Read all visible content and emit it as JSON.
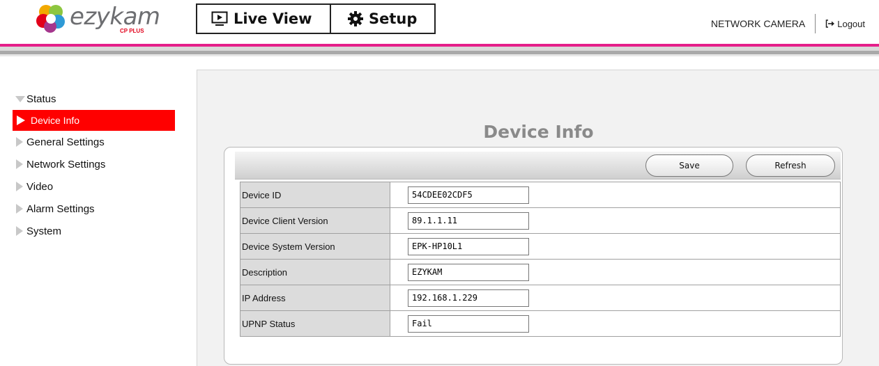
{
  "brand": {
    "name": "ezykam",
    "sub": "CP PLUS"
  },
  "nav": {
    "live_view": "Live View",
    "setup": "Setup"
  },
  "header": {
    "product": "NETWORK CAMERA",
    "logout": "Logout"
  },
  "sidebar": {
    "section": "Status",
    "active": "Device Info",
    "items": [
      "General Settings",
      "Network Settings",
      "Video",
      "Alarm Settings",
      "System"
    ]
  },
  "page": {
    "title": "Device Info",
    "save": "Save",
    "refresh": "Refresh"
  },
  "fields": [
    {
      "label": "Device ID",
      "value": "54CDEE02CDF5"
    },
    {
      "label": "Device Client Version",
      "value": "89.1.1.11"
    },
    {
      "label": "Device System Version",
      "value": "EPK-HP10L1"
    },
    {
      "label": "Description",
      "value": "EZYKAM"
    },
    {
      "label": "IP Address",
      "value": "192.168.1.229"
    },
    {
      "label": "UPNP Status",
      "value": "Fail"
    }
  ],
  "colors": {
    "brand_pink": "#e51f8a",
    "active_red": "#ff0000",
    "title_gray": "#8a8a8a"
  }
}
